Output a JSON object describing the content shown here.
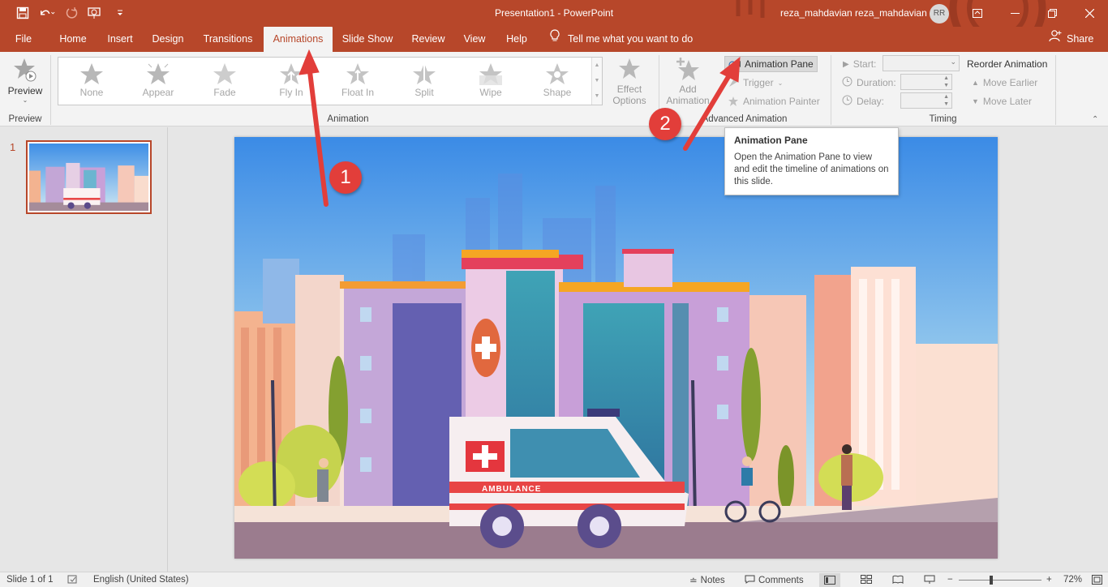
{
  "window": {
    "title": "Presentation1  -  PowerPoint",
    "user": "reza_mahdavian reza_mahdavian",
    "avatar_initials": "RR",
    "accent": "#b7472a"
  },
  "qat": [
    "save-icon",
    "undo-icon",
    "redo-icon",
    "start-from-beginning-icon",
    "customize-qat-icon"
  ],
  "tabs": [
    {
      "label": "File"
    },
    {
      "label": "Home"
    },
    {
      "label": "Insert"
    },
    {
      "label": "Design"
    },
    {
      "label": "Transitions"
    },
    {
      "label": "Animations"
    },
    {
      "label": "Slide Show"
    },
    {
      "label": "Review"
    },
    {
      "label": "View"
    },
    {
      "label": "Help"
    }
  ],
  "tell_me": "Tell me what you want to do",
  "share": "Share",
  "ribbon": {
    "preview": {
      "label": "Preview",
      "group": "Preview"
    },
    "animation_group": "Animation",
    "gallery": [
      "None",
      "Appear",
      "Fade",
      "Fly In",
      "Float In",
      "Split",
      "Wipe",
      "Shape"
    ],
    "effect_options": {
      "line1": "Effect",
      "line2": "Options"
    },
    "add_animation": {
      "line1": "Add",
      "line2": "Animation"
    },
    "advanced_group": "Advanced Animation",
    "animation_pane": "Animation Pane",
    "trigger": "Trigger",
    "animation_painter": "Animation Painter",
    "timing": {
      "start": "Start:",
      "duration": "Duration:",
      "delay": "Delay:",
      "reorder": "Reorder Animation",
      "move_earlier": "Move Earlier",
      "move_later": "Move Later",
      "group": "Timing"
    }
  },
  "tooltip": {
    "title": "Animation Pane",
    "body": "Open the Animation Pane to view and edit the timeline of animations on this slide."
  },
  "slides": {
    "number": "1"
  },
  "annotations": {
    "badge1": "1",
    "badge2": "2",
    "color": "#e23e3a"
  },
  "slide_text": {
    "ambulance": "AMBULANCE"
  },
  "status": {
    "slide_of": "Slide 1 of 1",
    "language": "English (United States)",
    "notes": "Notes",
    "comments": "Comments",
    "zoom": "72%"
  }
}
